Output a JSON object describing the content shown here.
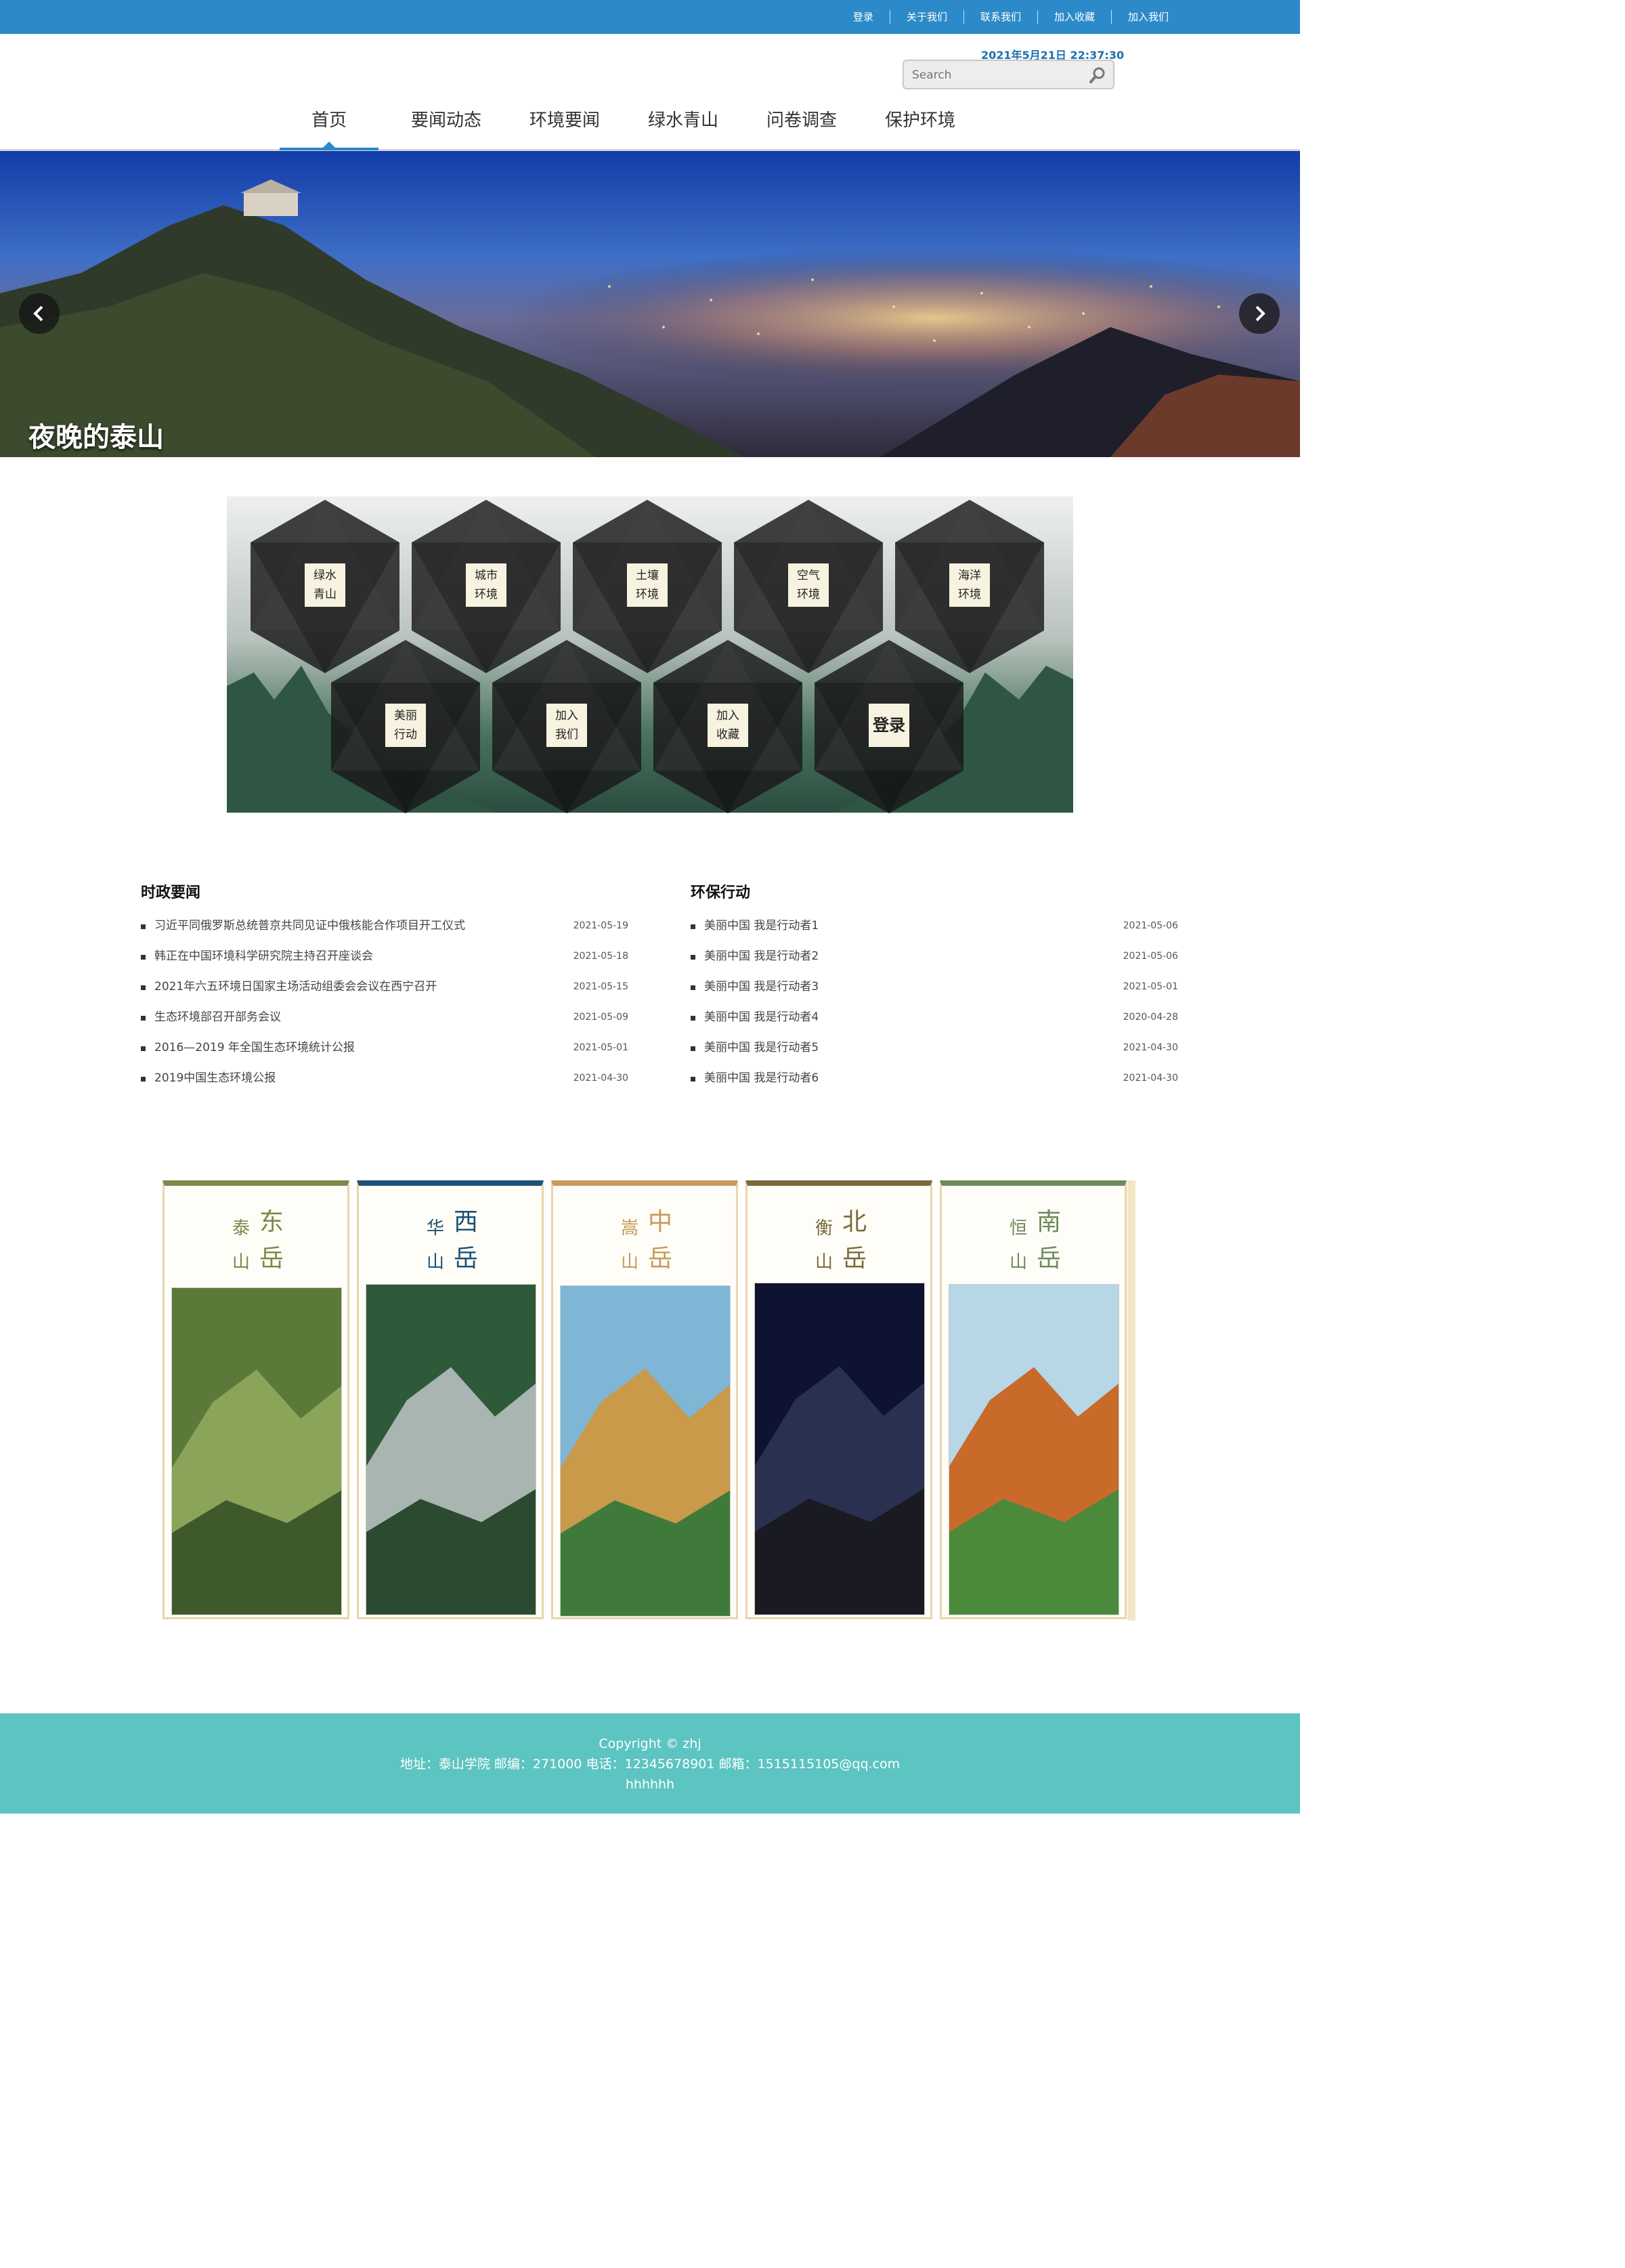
{
  "topbar": {
    "links": [
      "登录",
      "关于我们",
      "联系我们",
      "加入收藏",
      "加入我们"
    ]
  },
  "datetime": "2021年5月21日 22:37:30",
  "search": {
    "placeholder": "Search"
  },
  "nav": {
    "items": [
      "首页",
      "要闻动态",
      "环境要闻",
      "绿水青山",
      "问卷调查",
      "保护环境"
    ],
    "active": "首页"
  },
  "banner": {
    "caption": "夜晚的泰山"
  },
  "hex": {
    "top": [
      [
        "绿水",
        "青山"
      ],
      [
        "城市",
        "环境"
      ],
      [
        "土壤",
        "环境"
      ],
      [
        "空气",
        "环境"
      ],
      [
        "海洋",
        "环境"
      ]
    ],
    "bottom": [
      [
        "美丽",
        "行动"
      ],
      [
        "加入",
        "我们"
      ],
      [
        "加入",
        "收藏"
      ],
      [
        "登录"
      ]
    ]
  },
  "news_left": {
    "title": "时政要闻",
    "items": [
      {
        "text": "习近平同俄罗斯总统普京共同见证中俄核能合作项目开工仪式",
        "date": "2021-05-19"
      },
      {
        "text": "韩正在中国环境科学研究院主持召开座谈会",
        "date": "2021-05-18"
      },
      {
        "text": "2021年六五环境日国家主场活动组委会会议在西宁召开",
        "date": "2021-05-15"
      },
      {
        "text": "生态环境部召开部务会议",
        "date": "2021-05-09"
      },
      {
        "text": "2016—2019 年全国生态环境统计公报",
        "date": "2021-05-01"
      },
      {
        "text": "2019中国生态环境公报",
        "date": "2021-04-30"
      }
    ]
  },
  "news_right": {
    "title": "环保行动",
    "items": [
      {
        "text": "美丽中国 我是行动者1",
        "date": "2021-05-06"
      },
      {
        "text": "美丽中国 我是行动者2",
        "date": "2021-05-06"
      },
      {
        "text": "美丽中国 我是行动者3",
        "date": "2021-05-01"
      },
      {
        "text": "美丽中国 我是行动者4",
        "date": "2020-04-28"
      },
      {
        "text": "美丽中国 我是行动者5",
        "date": "2021-04-30"
      },
      {
        "text": "美丽中国 我是行动者6",
        "date": "2021-04-30"
      }
    ]
  },
  "cards": [
    {
      "small": [
        "泰",
        "山"
      ],
      "big": [
        "东",
        "岳"
      ],
      "color": "#7a8a4a"
    },
    {
      "small": [
        "华",
        "山"
      ],
      "big": [
        "西",
        "岳"
      ],
      "color": "#1c5277"
    },
    {
      "small": [
        "嵩",
        "山"
      ],
      "big": [
        "中",
        "岳"
      ],
      "color": "#c79a5c"
    },
    {
      "small": [
        "衡",
        "山"
      ],
      "big": [
        "北",
        "岳"
      ],
      "color": "#7b6a3c"
    },
    {
      "small": [
        "恒",
        "山"
      ],
      "big": [
        "南",
        "岳"
      ],
      "color": "#6f8a5a"
    }
  ],
  "footer": {
    "line1": "Copyright © zhj",
    "line2": "地址：泰山学院 邮编：271000 电话：12345678901 邮箱：1515115105@qq.com",
    "line3": "hhhhhh"
  },
  "colors": {
    "topbar": "#2c8ac8",
    "footer": "#5cc4c1",
    "accent": "#2c8ac8"
  }
}
